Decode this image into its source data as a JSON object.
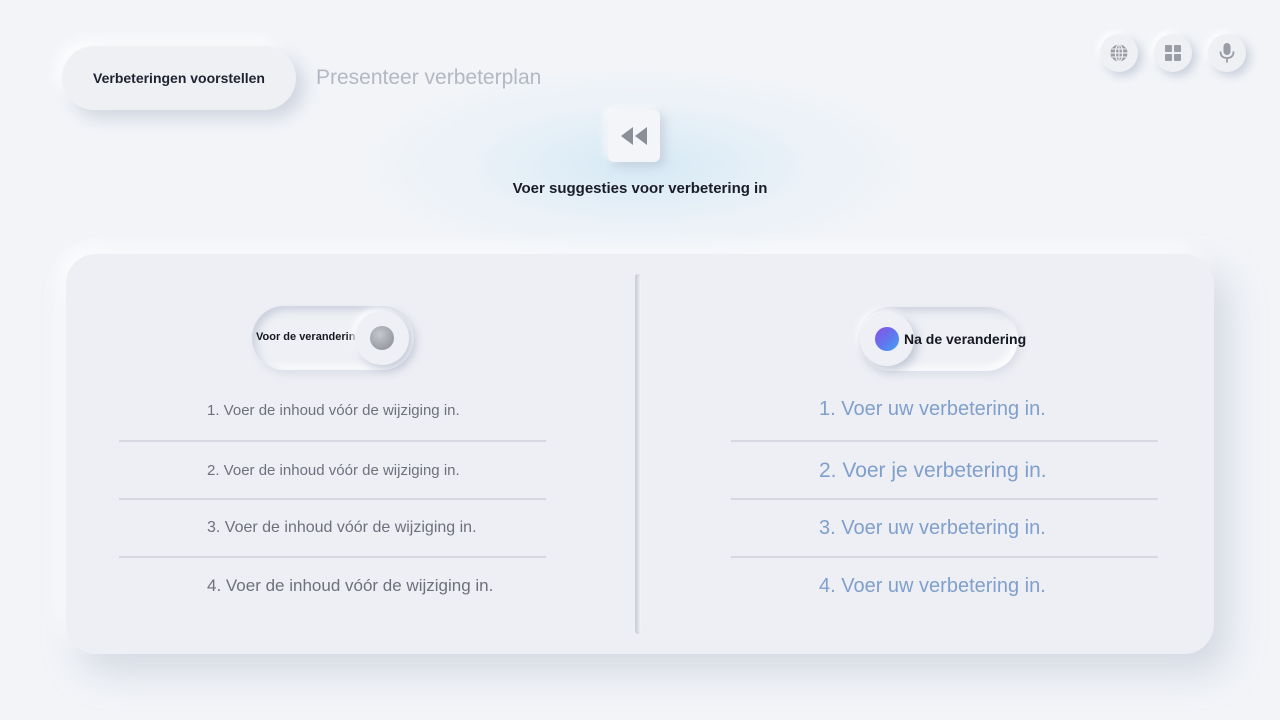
{
  "tabs": {
    "active_label": "Verbeteringen voorstellen",
    "inactive_label": "Presenteer verbeterplan"
  },
  "top_icons": [
    "globe-icon",
    "grid-icon",
    "microphone-icon"
  ],
  "header": {
    "subtitle": "Voer suggesties voor verbetering in"
  },
  "before": {
    "toggle_label": "Voor de verandering",
    "items": [
      "1. Voer de inhoud vóór de wijziging in.",
      "2. Voer de inhoud vóór de wijziging in.",
      "3. Voer de inhoud vóór de wijziging in.",
      "4. Voer de inhoud vóór de wijziging in."
    ]
  },
  "after": {
    "toggle_label": "Na de verandering",
    "items": [
      "1. Voer uw verbetering in.",
      "2. Voer je verbetering in.",
      "3. Voer uw verbetering in.",
      "4. Voer uw verbetering in."
    ]
  },
  "colors": {
    "background": "#f2f4f8",
    "after_text": "#7f9fcc",
    "before_text": "#6e717c",
    "accent_gradient_start": "#8a4fe6",
    "accent_gradient_end": "#41a7f2"
  }
}
